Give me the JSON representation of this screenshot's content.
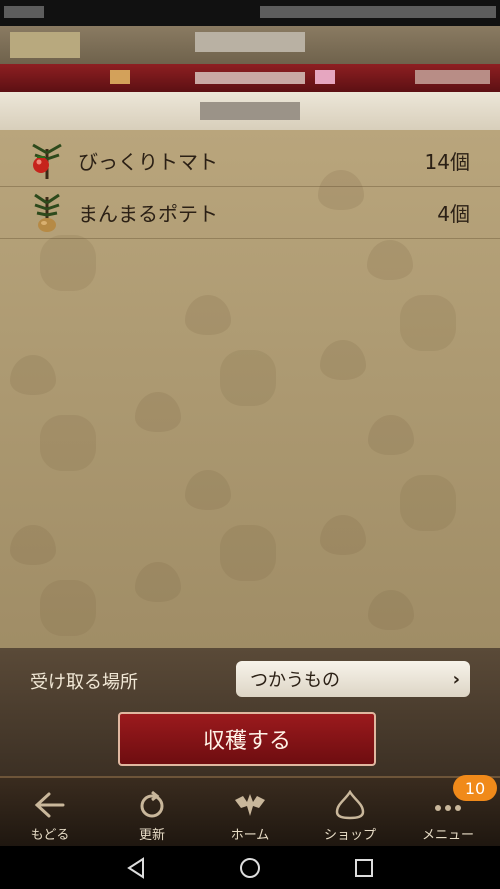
{
  "items": [
    {
      "name": "びっくりトマト",
      "count": "14個",
      "icon": "tomato-plant-icon"
    },
    {
      "name": "まんまるポテト",
      "count": "4個",
      "icon": "potato-plant-icon"
    }
  ],
  "controls": {
    "receive_label": "受け取る場所",
    "receive_value": "つかうもの",
    "harvest_label": "収穫する"
  },
  "nav": {
    "back": "もどる",
    "refresh": "更新",
    "home": "ホーム",
    "shop": "ショップ",
    "menu": "メニュー",
    "menu_badge": "10"
  },
  "colors": {
    "harvest_button": "#8a1417",
    "badge": "#f08a1a",
    "parchment": "#b09c74"
  }
}
